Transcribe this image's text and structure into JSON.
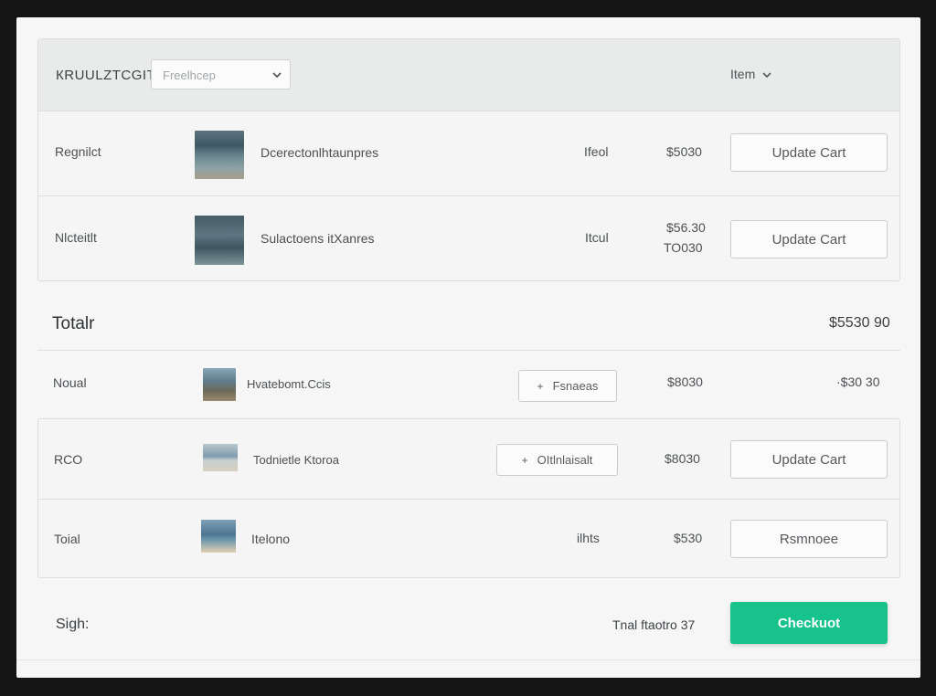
{
  "header": {
    "title": "КRUULZTCGIТ",
    "select_placeholder": "Freelhcep",
    "column_label": "Item"
  },
  "top_rows": [
    {
      "label": "Regnilct",
      "desc": "Dcerectonlhtaunpres",
      "qty": "Ifeol",
      "price": "$5030",
      "price2": "",
      "action": "Update Cart"
    },
    {
      "label": "Nlcteitlt",
      "desc": "Sulactoens itXanres",
      "qty": "Itcul",
      "price": "$56.30",
      "price2": "TO030",
      "action": "Update Cart"
    }
  ],
  "total": {
    "label": "Totalr",
    "value": "$5530 90"
  },
  "mid_row": {
    "label": "Noual",
    "desc": "Hvatebomt.Ccis",
    "button": "Fsnaeas",
    "price": "$8030",
    "price2": "·$30 30"
  },
  "bottom_rows": [
    {
      "label": "RCO",
      "desc": "Todnietle Ktoroa",
      "button": "OItlnlaisalt",
      "qty": "",
      "price": "$8030",
      "action": "Update Cart"
    },
    {
      "label": "Toial",
      "desc": "Itelono",
      "button": "",
      "qty": "ilhts",
      "price": "$530",
      "action": "Rsmnoee"
    }
  ],
  "footer": {
    "sign": "Sigh:",
    "total_text": "Tnal ftaotro 37",
    "checkout": "Checkuot"
  },
  "colors": {
    "accent": "#17c38b",
    "panel": "#f5f6f5",
    "header": "#e8ebea"
  },
  "icons": {
    "select_chevron": "chevron-down-icon",
    "column_chevron": "chevron-down-icon",
    "plus": "plus-icon"
  }
}
